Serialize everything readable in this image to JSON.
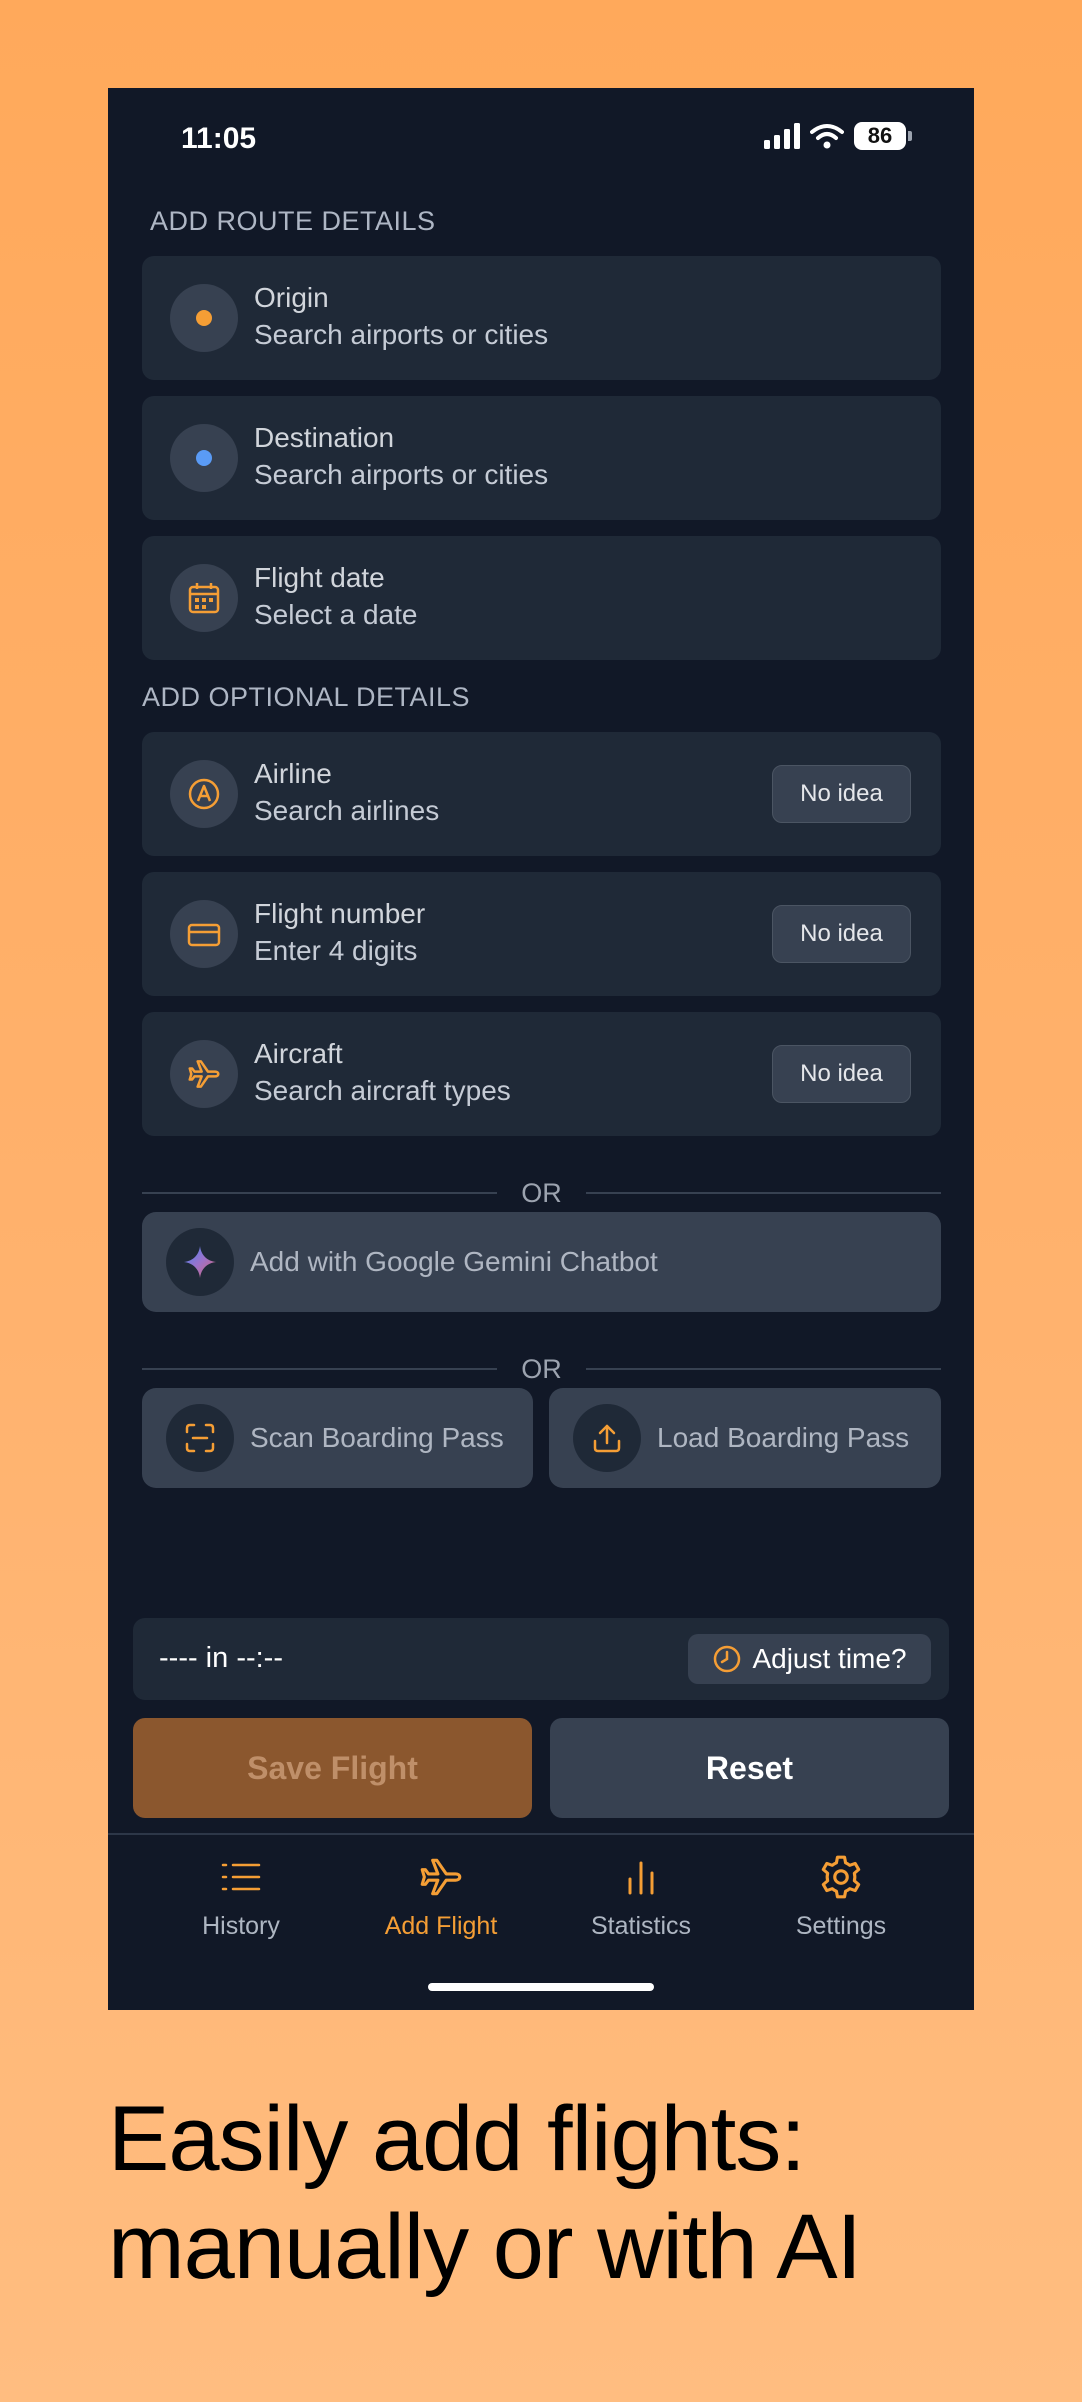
{
  "status_bar": {
    "time": "11:05",
    "battery": "86"
  },
  "sections": {
    "route": "ADD ROUTE DETAILS",
    "optional": "ADD OPTIONAL DETAILS"
  },
  "route_fields": [
    {
      "title": "Origin",
      "subtitle": "Search airports or cities",
      "icon": "orange-dot-icon"
    },
    {
      "title": "Destination",
      "subtitle": "Search airports or cities",
      "icon": "blue-dot-icon"
    },
    {
      "title": "Flight date",
      "subtitle": "Select a date",
      "icon": "calendar-icon"
    }
  ],
  "optional_fields": [
    {
      "title": "Airline",
      "subtitle": "Search airlines",
      "button": "No idea",
      "icon": "airline-icon"
    },
    {
      "title": "Flight number",
      "subtitle": "Enter 4 digits",
      "button": "No idea",
      "icon": "card-icon"
    },
    {
      "title": "Aircraft",
      "subtitle": "Search aircraft types",
      "button": "No idea",
      "icon": "plane-icon"
    }
  ],
  "divider_text": "OR",
  "gemini_button": "Add with Google Gemini Chatbot",
  "scan_button": "Scan Boarding Pass",
  "load_button": "Load Boarding Pass",
  "time_bar": {
    "text": "---- in --:--",
    "adjust": "Adjust time?"
  },
  "save_button": "Save Flight",
  "reset_button": "Reset",
  "nav": [
    {
      "label": "History",
      "icon": "list-icon",
      "active": false
    },
    {
      "label": "Add Flight",
      "icon": "plane-icon",
      "active": true
    },
    {
      "label": "Statistics",
      "icon": "bar-chart-icon",
      "active": false
    },
    {
      "label": "Settings",
      "icon": "gear-icon",
      "active": false
    }
  ],
  "caption": {
    "line1": "Easily add flights:",
    "line2": "manually or with AI"
  },
  "colors": {
    "accent": "#F59E35",
    "blue_dot": "#5A9BF6",
    "background": "#111827",
    "card": "#1F2937"
  }
}
